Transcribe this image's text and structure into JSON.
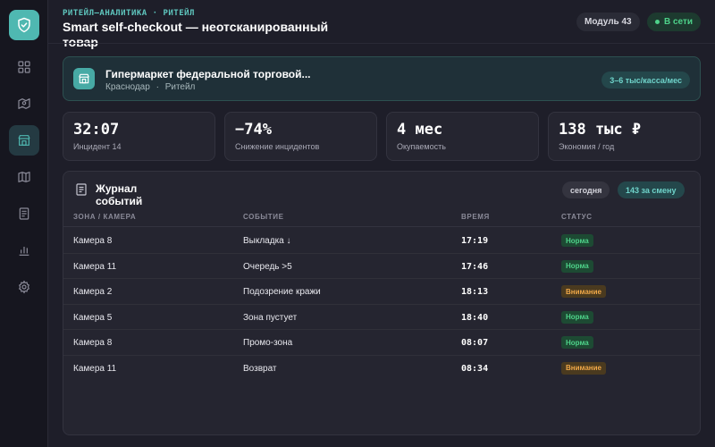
{
  "app": {
    "eyebrow": "РИТЕЙЛ–АНАЛИТИКА · РИТЕЙЛ",
    "title": "Smart self-checkout — неотсканированный товар",
    "module_label": "Модуль 43",
    "status_label": "В сети"
  },
  "sidebar": {
    "logo_icon": "shield-check-icon",
    "items": [
      {
        "icon": "dashboard-icon",
        "active": false
      },
      {
        "icon": "camera-map-icon",
        "active": false
      },
      {
        "icon": "store-icon",
        "active": true
      },
      {
        "icon": "map-icon",
        "active": false
      },
      {
        "icon": "report-icon",
        "active": false
      },
      {
        "icon": "bar-chart-icon",
        "active": false
      },
      {
        "icon": "gear-icon",
        "active": false
      }
    ]
  },
  "store": {
    "name": "Гипермаркет федеральной торговой...",
    "city": "Краснодар",
    "sector": "Ритейл",
    "separator": "·",
    "capacity_label": "3–6 тыс/касса/мес"
  },
  "stats": [
    {
      "value": "32:07",
      "label": "Инцидент 14"
    },
    {
      "value": "−74%",
      "label": "Снижение инцидентов"
    },
    {
      "value": "4 мес",
      "label": "Окупаемость"
    },
    {
      "value": "138 тыс ₽",
      "label": "Экономия / год"
    }
  ],
  "journal": {
    "title": "Журнал событий",
    "period_label": "сегодня",
    "count_label": "143 за смену",
    "columns": [
      "ЗОНА / КАМЕРА",
      "СОБЫТИЕ",
      "ВРЕМЯ",
      "СТАТУС"
    ],
    "rows": [
      {
        "zone": "Камера 8",
        "event": "Выкладка ↓",
        "time": "17:19",
        "status": "Норма",
        "level": "ok"
      },
      {
        "zone": "Камера 11",
        "event": "Очередь >5",
        "time": "17:46",
        "status": "Норма",
        "level": "ok"
      },
      {
        "zone": "Камера 2",
        "event": "Подозрение кражи",
        "time": "18:13",
        "status": "Внимание",
        "level": "warn"
      },
      {
        "zone": "Камера 5",
        "event": "Зона пустует",
        "time": "18:40",
        "status": "Норма",
        "level": "ok"
      },
      {
        "zone": "Камера 8",
        "event": "Промо-зона",
        "time": "08:07",
        "status": "Норма",
        "level": "ok"
      },
      {
        "zone": "Камера 11",
        "event": "Возврат",
        "time": "08:34",
        "status": "Внимание",
        "level": "warn"
      }
    ]
  },
  "colors": {
    "accent": "#4fb8b1",
    "ok": "#4ed28a",
    "warn": "#f0a848",
    "background": "#1e1e29"
  }
}
